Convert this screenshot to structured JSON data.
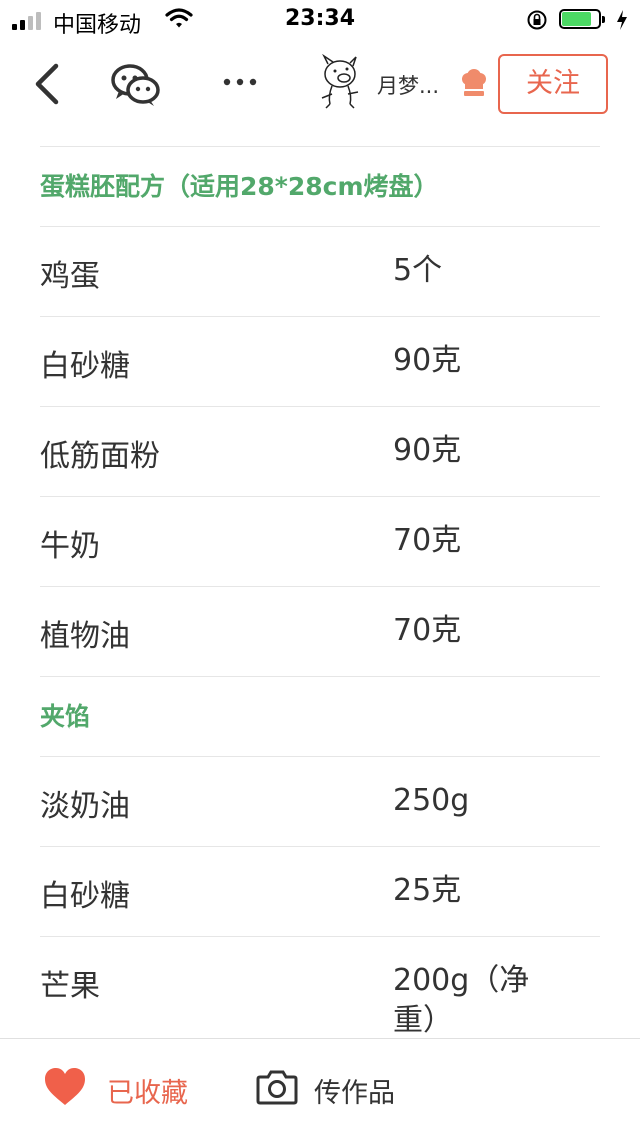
{
  "status_bar": {
    "carrier": "中国移动",
    "time": "23:34",
    "battery_color": "#4cd964"
  },
  "nav": {
    "back_icon": "chevron-left-icon",
    "wechat_icon": "wechat-icon",
    "more_icon": "more-dots-icon",
    "author_name": "月梦...",
    "chef_icon": "chef-hat-icon",
    "follow_label": "关注"
  },
  "ingredients": {
    "section_1": {
      "title": "蛋糕胚配方（适用28*28cm烤盘）",
      "items": [
        {
          "name": "鸡蛋",
          "amount": "5个"
        },
        {
          "name": "白砂糖",
          "amount": "90克"
        },
        {
          "name": "低筋面粉",
          "amount": "90克"
        },
        {
          "name": "牛奶",
          "amount": "70克"
        },
        {
          "name": "植物油",
          "amount": "70克"
        }
      ]
    },
    "section_2": {
      "title": "夹馅",
      "items": [
        {
          "name": "淡奶油",
          "amount": "250g"
        },
        {
          "name": "白砂糖",
          "amount": "25克"
        },
        {
          "name": "芒果",
          "amount": "200g（净重）"
        }
      ]
    }
  },
  "bottom_bar": {
    "favorite_label": "已收藏",
    "upload_label": "传作品",
    "accent_color": "#e8664e"
  },
  "colors": {
    "section_title": "#52a86b",
    "accent": "#e8664e",
    "divider": "#e6e6e6"
  }
}
